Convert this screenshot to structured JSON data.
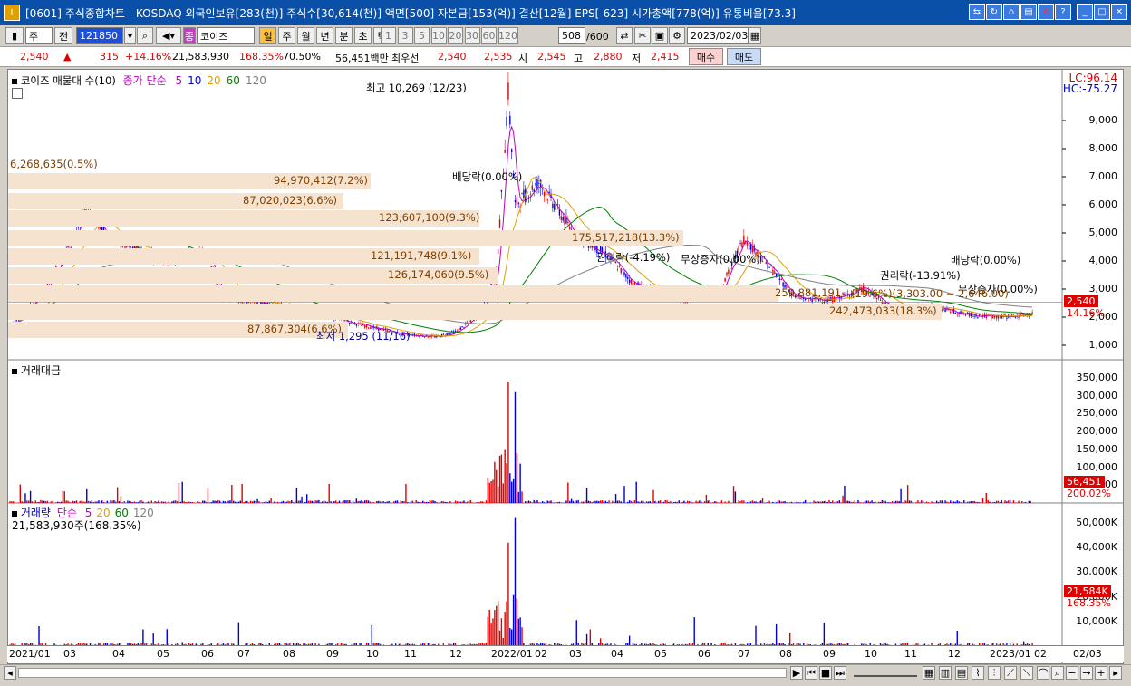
{
  "window": {
    "title": "[0601] 주식종합차트 - KOSDAQ 외국인보유[283(천)] 주식수[30,614(천)] 액면[500] 자본금[153(억)] 결산[12월] EPS[-623] 시가총액[778(억)] 유통비율[73.3]"
  },
  "toolbar": {
    "code": "121850",
    "name": "코이즈",
    "period_labels": [
      "일",
      "주",
      "월",
      "년",
      "분",
      "초",
      "틱"
    ],
    "interval_labels": [
      "1",
      "3",
      "5",
      "10",
      "20",
      "30",
      "60",
      "120"
    ],
    "count": "508",
    "count_total": "/600",
    "date": "2023/02/03",
    "prefix_1": "주",
    "prefix_2": "전"
  },
  "quote": {
    "price": "2,540",
    "change": "315",
    "change_pct": "+14.16%",
    "volume": "21,583,930",
    "vol_ratio": "168.35%",
    "turnover": "70.50%",
    "amount": "56,451백만",
    "best_label": "최우선",
    "ask": "2,540",
    "bid": "2,535",
    "open_label": "시",
    "open": "2,545",
    "high_label": "고",
    "high": "2,880",
    "low_label": "저",
    "low": "2,415",
    "buy_label": "매수",
    "sell_label": "매도"
  },
  "price_panel": {
    "legend_name": "코이즈 매물대 수(10)",
    "ma_label": "종가 단순",
    "ma_periods": [
      "5",
      "10",
      "20",
      "60",
      "120"
    ],
    "lc": "LC:96.14",
    "hc": "HC:-75.27",
    "y_ticks": [
      "9,000",
      "8,000",
      "7,000",
      "6,000",
      "5,000",
      "4,000",
      "3,000",
      "2,000",
      "1,000"
    ],
    "current_price": "2,540",
    "current_pct": "14.16%",
    "annotations": {
      "high": "최고 10,269 (12/23)",
      "low": "최저 1,295 (11/16)",
      "div1": "배당락(0.00%)",
      "rights1": "권리락(-4.19%)",
      "bonus1": "무상증자(0.00%)",
      "rights2": "권리락(-13.91%)",
      "div2": "배당락(0.00%)",
      "bonus2": "무상증자(0.00%)",
      "range": "(19.6%)(3,303.00 ~ 2,646.00)"
    },
    "bands": [
      "6,268,635(0.5%)",
      "94,970,412(7.2%)",
      "87,020,023(6.6%)",
      "123,607,100(9.3%)",
      "175,517,218(13.3%)",
      "121,191,748(9.1%)",
      "126,174,060(9.5%)",
      "259,881,191",
      "242,473,033(18.3%)",
      "87,867,304(6.6%)"
    ]
  },
  "amount_panel": {
    "title": "거래대금",
    "y_ticks": [
      "350,000",
      "300,000",
      "250,000",
      "200,000",
      "150,000",
      "100,000",
      "50,000"
    ],
    "current": "56,451",
    "current_pct": "200.02%"
  },
  "volume_panel": {
    "title": "거래량",
    "ma_label": "단순",
    "ma_periods": [
      "5",
      "20",
      "60",
      "120"
    ],
    "subtitle": "21,583,930주(168.35%)",
    "y_ticks": [
      "50,000K",
      "40,000K",
      "30,000K",
      "20,000K",
      "10,000K"
    ],
    "current": "21,584K",
    "current_pct": "168.35%"
  },
  "x_axis": [
    "2021/01",
    "03",
    "04",
    "05",
    "06",
    "07",
    "08",
    "09",
    "10",
    "11",
    "12",
    "2022/01",
    "02",
    "03",
    "04",
    "05",
    "06",
    "07",
    "08",
    "09",
    "10",
    "11",
    "12",
    "2023/01",
    "02",
    "02/03"
  ],
  "colors": {
    "up": "#e00000",
    "down": "#0000d0",
    "band": "#f6e3cf",
    "title_bg": "#0a4fa8"
  }
}
